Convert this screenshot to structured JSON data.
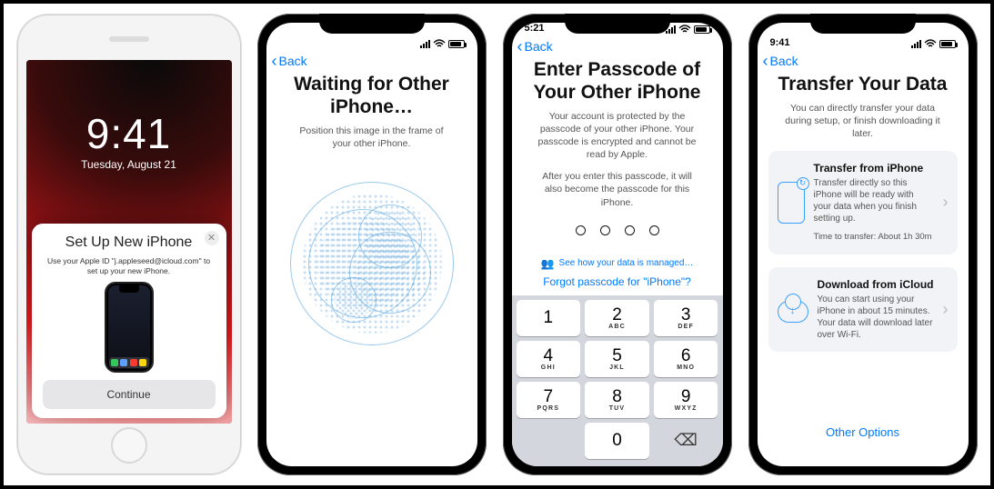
{
  "phone1": {
    "time": "9:41",
    "date": "Tuesday, August 21",
    "sheet_title": "Set Up New iPhone",
    "sheet_text": "Use your Apple ID \"j.appleseed@icloud.com\" to set up your new iPhone.",
    "continue": "Continue",
    "close_glyph": "✕"
  },
  "phone2": {
    "back": "Back",
    "title": "Waiting for Other iPhone…",
    "sub": "Position this image in the frame of your other iPhone."
  },
  "phone3": {
    "time": "5:21",
    "back": "Back",
    "title": "Enter Passcode of Your Other iPhone",
    "sub1": "Your account is protected by the passcode of your other iPhone. Your passcode is encrypted and cannot be read by Apple.",
    "sub2": "After you enter this passcode, it will also become the passcode for this iPhone.",
    "managed": "See how your data is managed…",
    "forgot": "Forgot passcode for \"iPhone\"?",
    "keys": {
      "1": {
        "n": "1",
        "l": ""
      },
      "2": {
        "n": "2",
        "l": "ABC"
      },
      "3": {
        "n": "3",
        "l": "DEF"
      },
      "4": {
        "n": "4",
        "l": "GHI"
      },
      "5": {
        "n": "5",
        "l": "JKL"
      },
      "6": {
        "n": "6",
        "l": "MNO"
      },
      "7": {
        "n": "7",
        "l": "PQRS"
      },
      "8": {
        "n": "8",
        "l": "TUV"
      },
      "9": {
        "n": "9",
        "l": "WXYZ"
      },
      "0": {
        "n": "0",
        "l": ""
      }
    },
    "del_glyph": "⌫"
  },
  "phone4": {
    "time": "9:41",
    "back": "Back",
    "title": "Transfer Your Data",
    "sub": "You can directly transfer your data during setup, or finish downloading it later.",
    "card1": {
      "title": "Transfer from iPhone",
      "text": "Transfer directly so this iPhone will be ready with your data when you finish setting up.",
      "meta": "Time to transfer: About 1h 30m"
    },
    "card2": {
      "title": "Download from iCloud",
      "text": "You can start using your iPhone in about 15 minutes. Your data will download later over Wi-Fi."
    },
    "other": "Other Options"
  }
}
